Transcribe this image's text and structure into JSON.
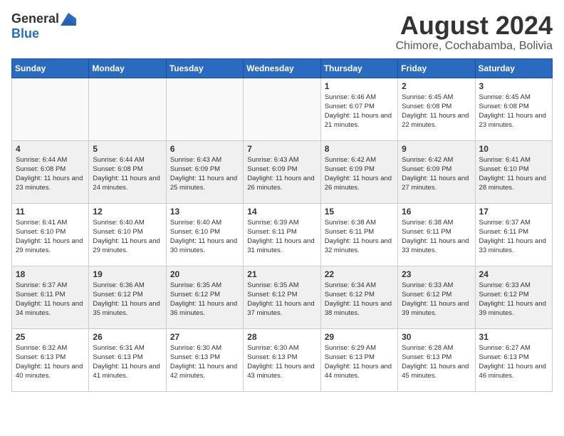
{
  "header": {
    "logo_general": "General",
    "logo_blue": "Blue",
    "month": "August 2024",
    "location": "Chimore, Cochabamba, Bolivia"
  },
  "days_of_week": [
    "Sunday",
    "Monday",
    "Tuesday",
    "Wednesday",
    "Thursday",
    "Friday",
    "Saturday"
  ],
  "weeks": [
    [
      {
        "day": "",
        "empty": true
      },
      {
        "day": "",
        "empty": true
      },
      {
        "day": "",
        "empty": true
      },
      {
        "day": "",
        "empty": true
      },
      {
        "day": "1",
        "sunrise": "6:46 AM",
        "sunset": "6:07 PM",
        "daylight": "11 hours and 21 minutes."
      },
      {
        "day": "2",
        "sunrise": "6:45 AM",
        "sunset": "6:08 PM",
        "daylight": "11 hours and 22 minutes."
      },
      {
        "day": "3",
        "sunrise": "6:45 AM",
        "sunset": "6:08 PM",
        "daylight": "11 hours and 23 minutes."
      }
    ],
    [
      {
        "day": "4",
        "sunrise": "6:44 AM",
        "sunset": "6:08 PM",
        "daylight": "11 hours and 23 minutes."
      },
      {
        "day": "5",
        "sunrise": "6:44 AM",
        "sunset": "6:08 PM",
        "daylight": "11 hours and 24 minutes."
      },
      {
        "day": "6",
        "sunrise": "6:43 AM",
        "sunset": "6:09 PM",
        "daylight": "11 hours and 25 minutes."
      },
      {
        "day": "7",
        "sunrise": "6:43 AM",
        "sunset": "6:09 PM",
        "daylight": "11 hours and 26 minutes."
      },
      {
        "day": "8",
        "sunrise": "6:42 AM",
        "sunset": "6:09 PM",
        "daylight": "11 hours and 26 minutes."
      },
      {
        "day": "9",
        "sunrise": "6:42 AM",
        "sunset": "6:09 PM",
        "daylight": "11 hours and 27 minutes."
      },
      {
        "day": "10",
        "sunrise": "6:41 AM",
        "sunset": "6:10 PM",
        "daylight": "11 hours and 28 minutes."
      }
    ],
    [
      {
        "day": "11",
        "sunrise": "6:41 AM",
        "sunset": "6:10 PM",
        "daylight": "11 hours and 29 minutes."
      },
      {
        "day": "12",
        "sunrise": "6:40 AM",
        "sunset": "6:10 PM",
        "daylight": "11 hours and 29 minutes."
      },
      {
        "day": "13",
        "sunrise": "6:40 AM",
        "sunset": "6:10 PM",
        "daylight": "11 hours and 30 minutes."
      },
      {
        "day": "14",
        "sunrise": "6:39 AM",
        "sunset": "6:11 PM",
        "daylight": "11 hours and 31 minutes."
      },
      {
        "day": "15",
        "sunrise": "6:38 AM",
        "sunset": "6:11 PM",
        "daylight": "11 hours and 32 minutes."
      },
      {
        "day": "16",
        "sunrise": "6:38 AM",
        "sunset": "6:11 PM",
        "daylight": "11 hours and 33 minutes."
      },
      {
        "day": "17",
        "sunrise": "6:37 AM",
        "sunset": "6:11 PM",
        "daylight": "11 hours and 33 minutes."
      }
    ],
    [
      {
        "day": "18",
        "sunrise": "6:37 AM",
        "sunset": "6:11 PM",
        "daylight": "11 hours and 34 minutes."
      },
      {
        "day": "19",
        "sunrise": "6:36 AM",
        "sunset": "6:12 PM",
        "daylight": "11 hours and 35 minutes."
      },
      {
        "day": "20",
        "sunrise": "6:35 AM",
        "sunset": "6:12 PM",
        "daylight": "11 hours and 36 minutes."
      },
      {
        "day": "21",
        "sunrise": "6:35 AM",
        "sunset": "6:12 PM",
        "daylight": "11 hours and 37 minutes."
      },
      {
        "day": "22",
        "sunrise": "6:34 AM",
        "sunset": "6:12 PM",
        "daylight": "11 hours and 38 minutes."
      },
      {
        "day": "23",
        "sunrise": "6:33 AM",
        "sunset": "6:12 PM",
        "daylight": "11 hours and 39 minutes."
      },
      {
        "day": "24",
        "sunrise": "6:33 AM",
        "sunset": "6:12 PM",
        "daylight": "11 hours and 39 minutes."
      }
    ],
    [
      {
        "day": "25",
        "sunrise": "6:32 AM",
        "sunset": "6:13 PM",
        "daylight": "11 hours and 40 minutes."
      },
      {
        "day": "26",
        "sunrise": "6:31 AM",
        "sunset": "6:13 PM",
        "daylight": "11 hours and 41 minutes."
      },
      {
        "day": "27",
        "sunrise": "6:30 AM",
        "sunset": "6:13 PM",
        "daylight": "11 hours and 42 minutes."
      },
      {
        "day": "28",
        "sunrise": "6:30 AM",
        "sunset": "6:13 PM",
        "daylight": "11 hours and 43 minutes."
      },
      {
        "day": "29",
        "sunrise": "6:29 AM",
        "sunset": "6:13 PM",
        "daylight": "11 hours and 44 minutes."
      },
      {
        "day": "30",
        "sunrise": "6:28 AM",
        "sunset": "6:13 PM",
        "daylight": "11 hours and 45 minutes."
      },
      {
        "day": "31",
        "sunrise": "6:27 AM",
        "sunset": "6:13 PM",
        "daylight": "11 hours and 46 minutes."
      }
    ]
  ]
}
